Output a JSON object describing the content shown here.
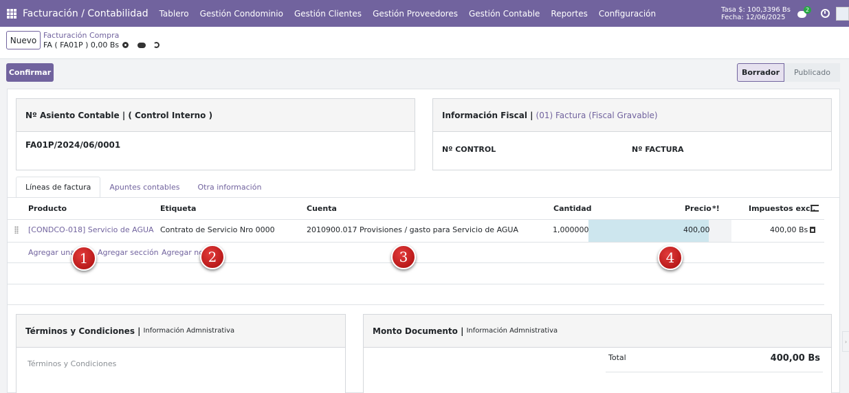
{
  "navbar": {
    "brand": "Facturación / Contabilidad",
    "menu": [
      "Tablero",
      "Gestión Condominio",
      "Gestión Clientes",
      "Gestión Proveedores",
      "Gestión Contable",
      "Reportes",
      "Configuración"
    ],
    "rate": "Tasa $: 100,3396 Bs",
    "date": "Fecha: 12/06/2025",
    "messages_count": "2"
  },
  "control_panel": {
    "new_label": "Nuevo",
    "breadcrumb_parent": "Facturación Compra",
    "breadcrumb_current": "FA ( FA01P ) 0,00 Bs"
  },
  "actions": {
    "confirm_label": "Confirmar",
    "status": [
      "Borrador",
      "Publicado"
    ],
    "active_status": "Borrador"
  },
  "accounting_card": {
    "title": "Nº Asiento Contable | ( Control Interno )",
    "entry_number": "FA01P/2024/06/0001"
  },
  "fiscal_card": {
    "title": "Información Fiscal |",
    "fiscal_type": "(01) Factura (Fiscal Gravable)",
    "control_label": "Nº CONTROL",
    "invoice_label": "Nº FACTURA"
  },
  "tabs": [
    "Líneas de factura",
    "Apuntes contables",
    "Otra información"
  ],
  "lines_table": {
    "headers": [
      "Producto",
      "Etiqueta",
      "Cuenta",
      "Cantidad",
      "Precio",
      "*!",
      "Impuestos excl."
    ],
    "rows": [
      {
        "product": "[CONDCO-018] Servicio de AGUA",
        "label": "Contrato de Servicio Nro 0000",
        "account": "2010900.017 Provisiones / gasto para Servicio de AGUA",
        "quantity": "1,000000",
        "price": "400,00",
        "subtotal": "400,00 Bs"
      }
    ],
    "add_line": "Agregar una",
    "add_section": "Agregar sección",
    "add_note": "Agregar no"
  },
  "annotations": [
    "1",
    "2",
    "3",
    "4"
  ],
  "terms_card": {
    "title": "Términos y Condiciones |",
    "subtitle": "Información Admnistrativa",
    "placeholder": "Términos y Condiciones"
  },
  "amount_card": {
    "title": "Monto Documento |",
    "subtitle": "Información Admnistrativa",
    "total_label": "Total",
    "total_value": "400,00 Bs"
  },
  "colors": {
    "brand": "#71639e",
    "highlight_cell": "#cde6ee",
    "annotation": "#c41a1a"
  }
}
